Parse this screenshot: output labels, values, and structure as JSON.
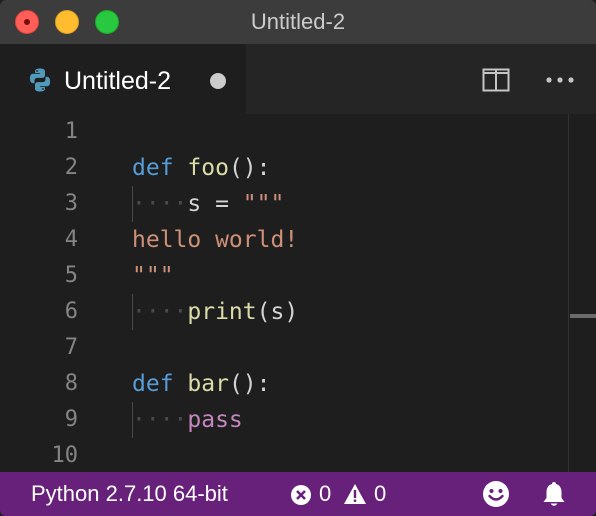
{
  "window": {
    "title": "Untitled-2"
  },
  "tab": {
    "label": "Untitled-2",
    "icon": "python-icon",
    "dirty": true
  },
  "editor": {
    "line_numbers": [
      "1",
      "2",
      "3",
      "4",
      "5",
      "6",
      "7",
      "8",
      "9",
      "10"
    ],
    "lines": [
      {
        "n": "1",
        "tokens": []
      },
      {
        "n": "2",
        "tokens": [
          [
            "kw",
            "def"
          ],
          [
            "",
            " "
          ],
          [
            "fn",
            "foo"
          ],
          [
            "",
            "():"
          ]
        ]
      },
      {
        "n": "3",
        "tokens": [
          [
            "ws",
            "····"
          ],
          [
            "",
            "s = "
          ],
          [
            "str",
            "\"\"\""
          ]
        ]
      },
      {
        "n": "4",
        "tokens": [
          [
            "str",
            "hello world!"
          ]
        ]
      },
      {
        "n": "5",
        "tokens": [
          [
            "str",
            "\"\"\""
          ]
        ]
      },
      {
        "n": "6",
        "tokens": [
          [
            "ws",
            "····"
          ],
          [
            "fn",
            "print"
          ],
          [
            "",
            "(s)"
          ]
        ]
      },
      {
        "n": "7",
        "tokens": []
      },
      {
        "n": "8",
        "tokens": [
          [
            "kw",
            "def"
          ],
          [
            "",
            " "
          ],
          [
            "fn",
            "bar"
          ],
          [
            "",
            "():"
          ]
        ]
      },
      {
        "n": "9",
        "tokens": [
          [
            "ws",
            "····"
          ],
          [
            "ctl",
            "pass"
          ]
        ]
      },
      {
        "n": "10",
        "tokens": []
      }
    ]
  },
  "status": {
    "language": "Python 2.7.10 64-bit",
    "errors": "0",
    "warnings": "0"
  },
  "colors": {
    "statusbar": "#68217a",
    "keyword": "#569cd6",
    "function": "#dcdcaa",
    "string": "#ce9178",
    "control": "#c586c0"
  }
}
